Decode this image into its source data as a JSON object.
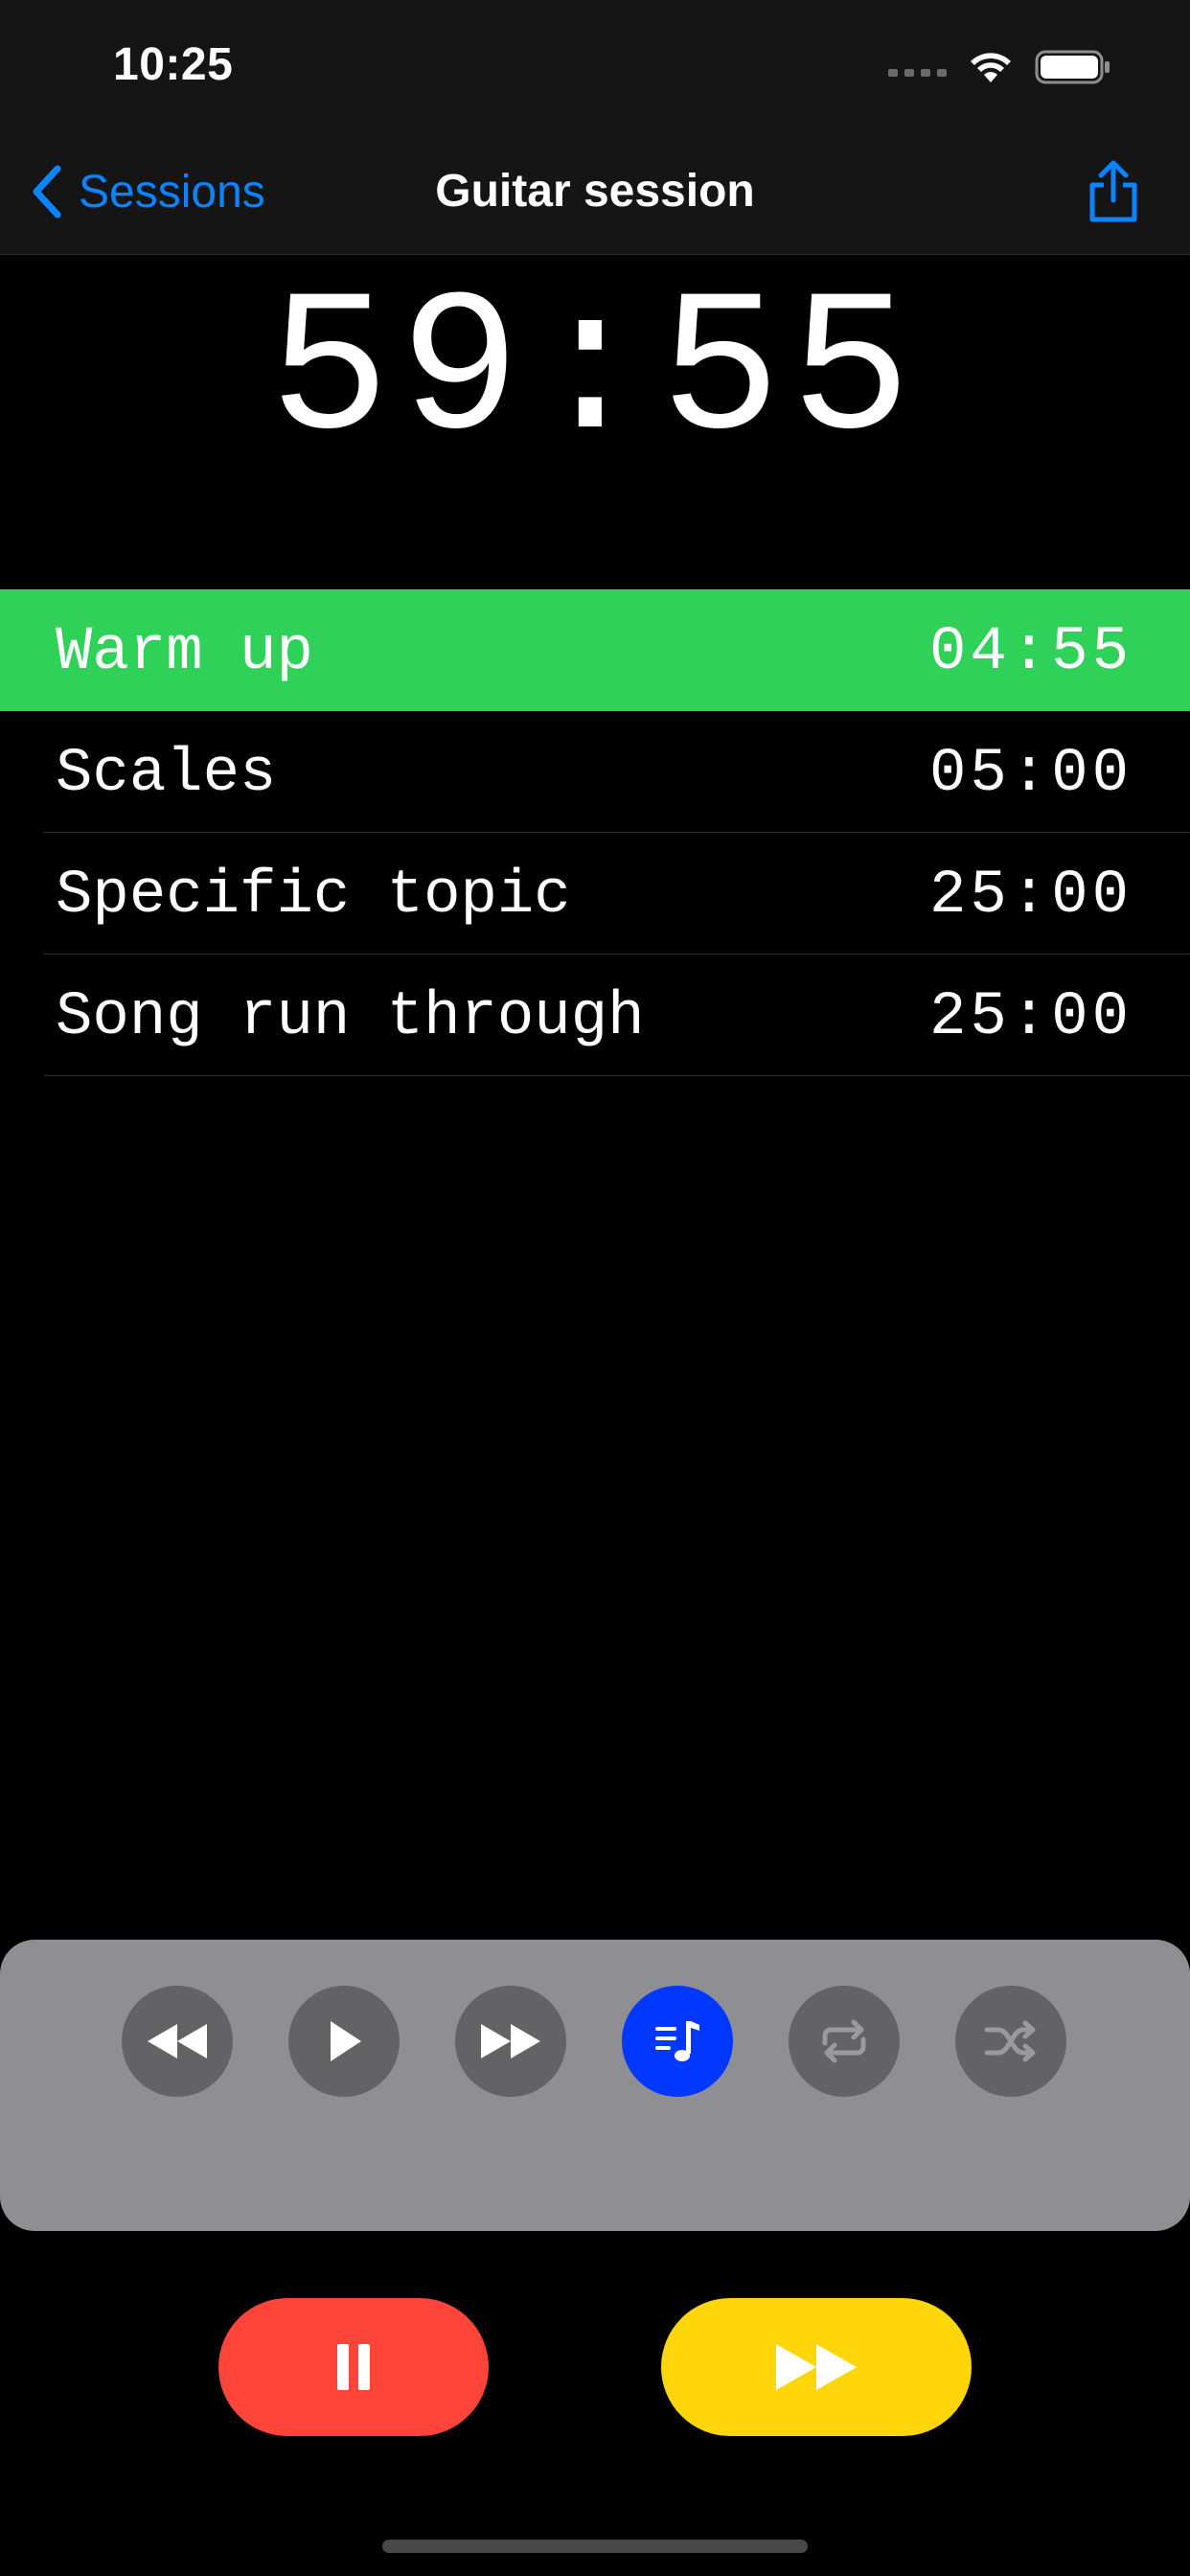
{
  "status_bar": {
    "time": "10:25"
  },
  "nav": {
    "back_label": "Sessions",
    "title": "Guitar session"
  },
  "timer": {
    "remaining": "59:55"
  },
  "segments": [
    {
      "name": "Warm up",
      "duration": "04:55",
      "active": true
    },
    {
      "name": "Scales",
      "duration": "05:00",
      "active": false
    },
    {
      "name": "Specific topic",
      "duration": "25:00",
      "active": false
    },
    {
      "name": "Song run through",
      "duration": "25:00",
      "active": false
    }
  ],
  "player_controls": [
    {
      "icon": "rewind-icon"
    },
    {
      "icon": "play-icon"
    },
    {
      "icon": "fast-forward-icon"
    },
    {
      "icon": "music-playlist-icon",
      "selected": true
    },
    {
      "icon": "repeat-icon"
    },
    {
      "icon": "shuffle-icon"
    }
  ],
  "colors": {
    "accent": "#0a84ff",
    "active_row": "#30d158",
    "pause": "#ff453a",
    "skip": "#ffd60a",
    "selected_control": "#0038ff"
  }
}
